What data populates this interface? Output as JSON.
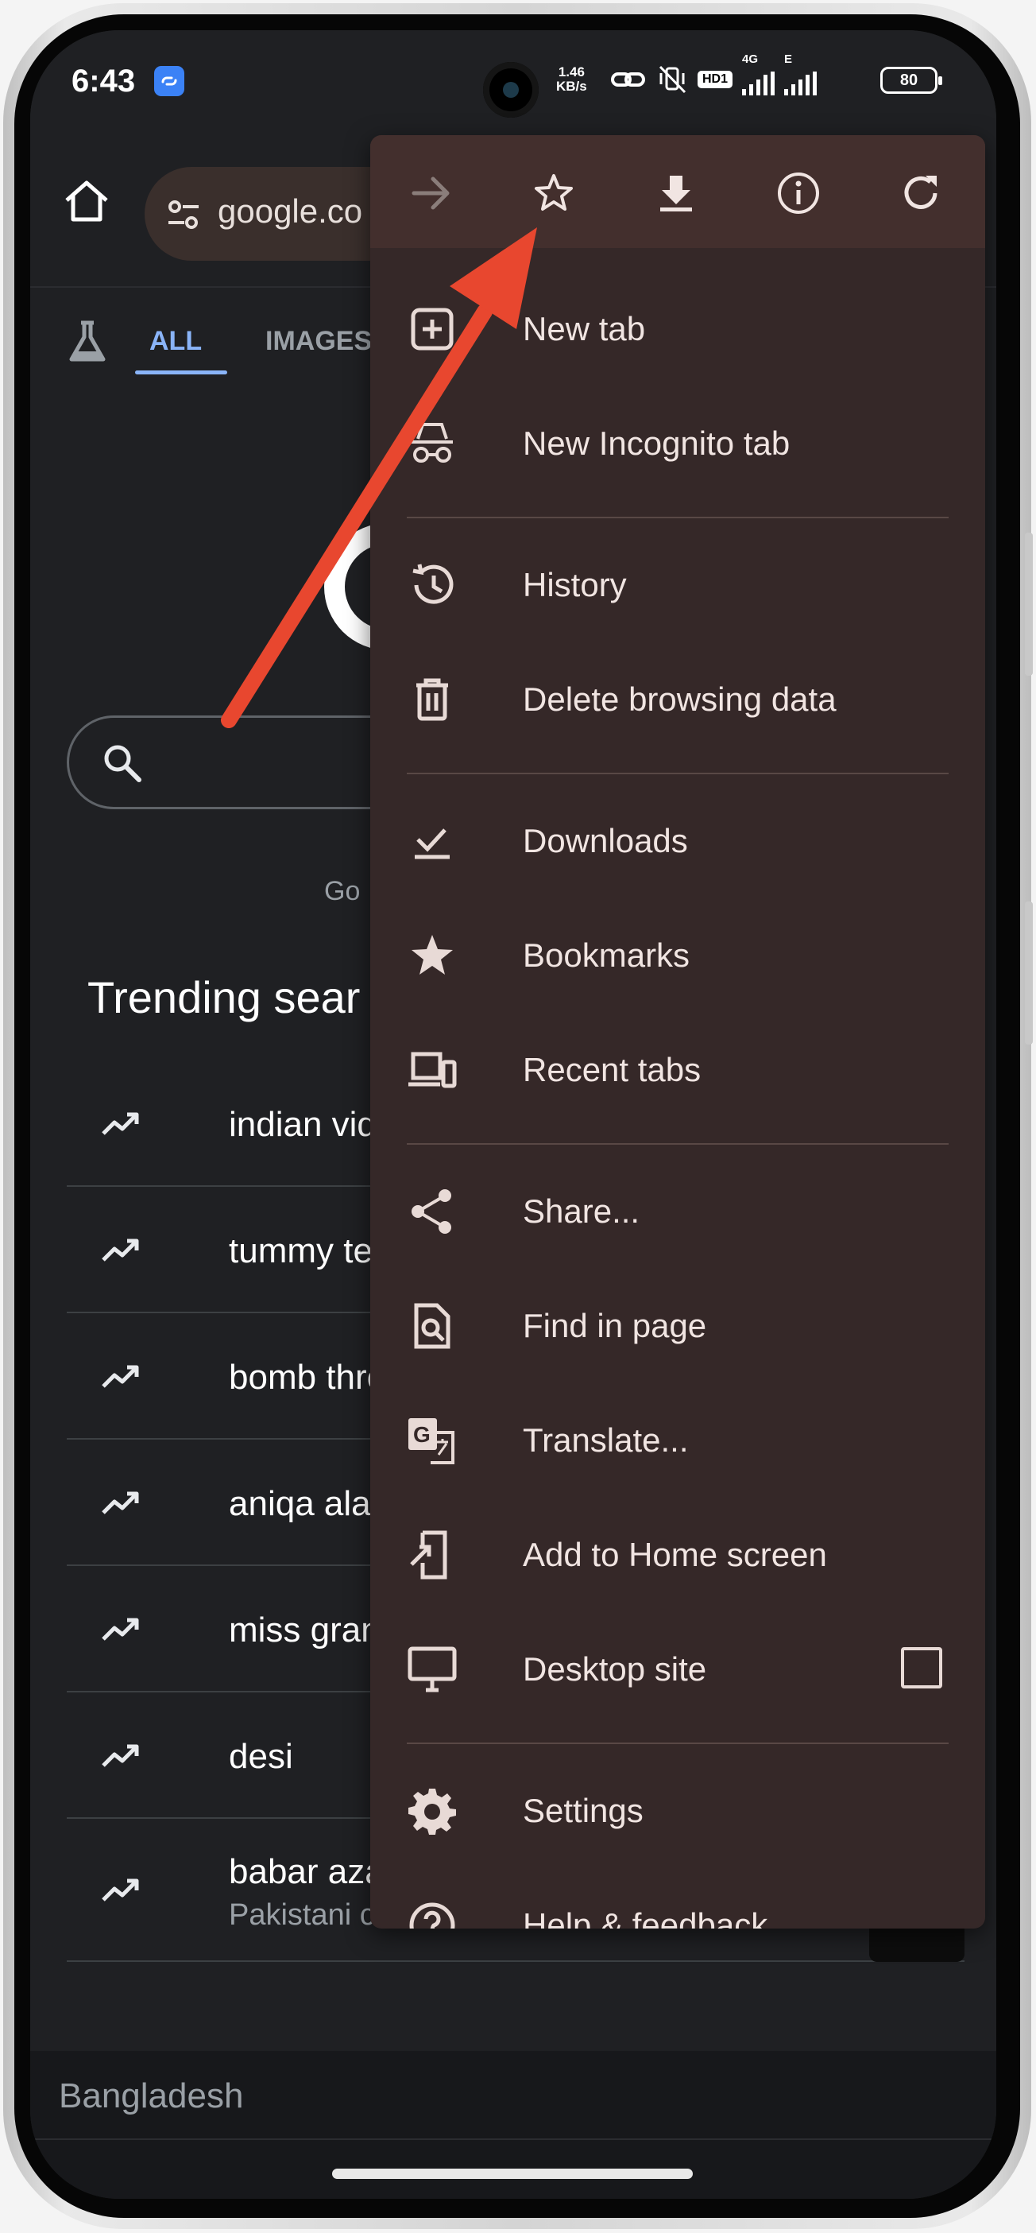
{
  "status_bar": {
    "time": "6:43",
    "net_speed_value": "1.46",
    "net_speed_unit": "KB/s",
    "hd_badge": "HD1",
    "net_type_1": "4G",
    "net_type_2": "E",
    "battery": "80"
  },
  "toolbar": {
    "url": "google.co"
  },
  "search_tabs": {
    "all": "ALL",
    "images": "IMAGES"
  },
  "offered_in": "Go",
  "trending": {
    "title": "Trending sear",
    "items": [
      {
        "label": "indian vid"
      },
      {
        "label": "tummy tea"
      },
      {
        "label": "bomb thre"
      },
      {
        "label": "aniqa alan"
      },
      {
        "label": "miss gran"
      },
      {
        "label": "desi"
      },
      {
        "label": "babar aza",
        "sub": "Pakistani cricketer"
      }
    ]
  },
  "footer": {
    "country": "Bangladesh"
  },
  "menu": {
    "items": {
      "new_tab": "New tab",
      "new_incognito_tab": "New Incognito tab",
      "history": "History",
      "delete_browsing_data": "Delete browsing data",
      "downloads": "Downloads",
      "bookmarks": "Bookmarks",
      "recent_tabs": "Recent tabs",
      "share": "Share...",
      "find_in_page": "Find in page",
      "translate": "Translate...",
      "add_to_home_screen": "Add to Home screen",
      "desktop_site": "Desktop site",
      "settings": "Settings",
      "help_feedback": "Help & feedback"
    },
    "desktop_site_checked": false
  },
  "colors": {
    "background": "#1f2023",
    "menu_background": "#352828",
    "menu_topbar": "#432f2d",
    "accent_blue": "#8ab4f8",
    "annotation_arrow": "#e8472f"
  }
}
